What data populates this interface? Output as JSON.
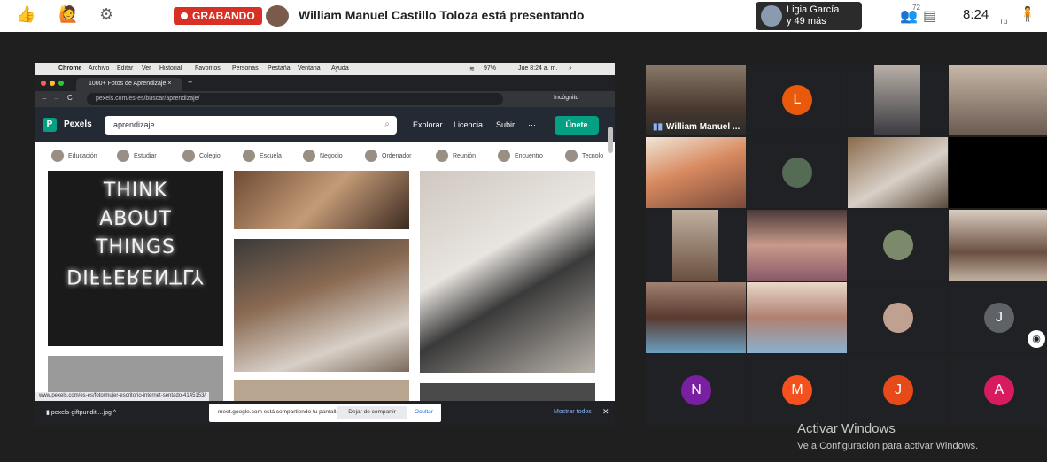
{
  "meet": {
    "recording_label": "GRABANDO",
    "presenting_text": "William Manuel Castillo Toloza está presentando",
    "participants_name": "Ligia García",
    "participants_more": "y 49 más",
    "people_count": "72",
    "clock": "8:24",
    "you_label": "Tú",
    "colors": {
      "record_red": "#d93025"
    }
  },
  "browser": {
    "mac_menu": [
      "Chrome",
      "Archivo",
      "Editar",
      "Ver",
      "Historial",
      "Favoritos",
      "Personas",
      "Pestaña",
      "Ventana",
      "Ayuda"
    ],
    "mac_status": "97%",
    "mac_datetime": "Jue 8:24 a. m.",
    "tab_title": "1000+ Fotos de Aprendizaje",
    "url": "pexels.com/es-es/buscar/aprendizaje/",
    "incognito_label": "Incógnito",
    "status_url": "www.pexels.com/es-es/foto/mujer-escritorio-internet-sentado-4145153/",
    "download_file": "pexels-giftpundit....jpg",
    "share_notice": "meet.google.com está compartiendo tu pantalla.",
    "stop_share": "Dejar de compartir",
    "hide": "Ocultar",
    "show_all": "Mostrar todos"
  },
  "pexels": {
    "brand": "Pexels",
    "search_value": "aprendizaje",
    "nav": [
      "Explorar",
      "Licencia",
      "Subir",
      "···"
    ],
    "join": "Únete",
    "categories": [
      "Educación",
      "Estudiar",
      "Colegio",
      "Escuela",
      "Negocio",
      "Ordenador",
      "Reunión",
      "Encuentro",
      "Tecnolo"
    ],
    "poster_lines": [
      "THINK",
      "ABOUT",
      "THINGS",
      "DIFFERENTLY"
    ],
    "accent": "#05a081"
  },
  "participants": {
    "presenter_label": "William Manuel ...",
    "letters": [
      {
        "letter": "L",
        "color": "#e8590c"
      },
      {
        "letter": "J",
        "color": "#5f6368"
      },
      {
        "letter": "N",
        "color": "#7b1fa2"
      },
      {
        "letter": "M",
        "color": "#f4511e"
      },
      {
        "letter": "J",
        "color": "#e64a19"
      },
      {
        "letter": "A",
        "color": "#d81b60"
      }
    ]
  },
  "windows": {
    "activate_title": "Activar Windows",
    "activate_sub": "Ve a Configuración para activar Windows."
  }
}
